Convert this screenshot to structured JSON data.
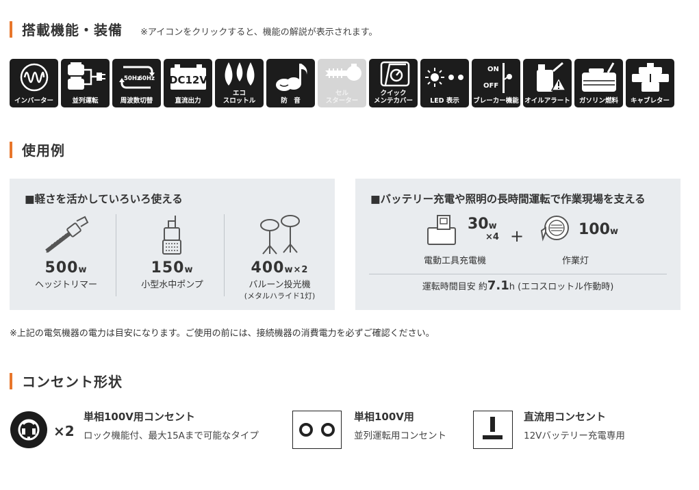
{
  "features": {
    "title": "搭載機能・装備",
    "note": "※アイコンをクリックすると、機能の解説が表示されます。",
    "icons": [
      {
        "label": "インバーター",
        "icon": "inverter-wave-icon"
      },
      {
        "label": "並列運転",
        "icon": "parallel-operation-icon"
      },
      {
        "label": "周波数切替",
        "icon": "frequency-switch-icon",
        "hz_a": "50Hz",
        "hz_b": "60Hz"
      },
      {
        "label": "直流出力",
        "icon": "dc-output-battery-icon",
        "text": "DC12V"
      },
      {
        "label": "エコ\nスロットル",
        "label_a": "エコ",
        "label_b": "スロットル",
        "icon": "eco-throttle-leaf-icon"
      },
      {
        "label": "防　音",
        "icon": "soundproof-note-icon"
      },
      {
        "label": "セル\nスターター",
        "label_a": "セル",
        "label_b": "スターター",
        "icon": "cell-starter-key-icon",
        "disabled": true
      },
      {
        "label": "クイック\nメンテカバー",
        "label_a": "クイック",
        "label_b": "メンテカバー",
        "icon": "quick-maintenance-cover-icon"
      },
      {
        "label": "LED 表示",
        "icon": "led-display-icon"
      },
      {
        "label": "ブレーカー機能",
        "icon": "breaker-switch-icon",
        "on": "ON",
        "off": "OFF"
      },
      {
        "label": "オイルアラート",
        "icon": "oil-alert-icon"
      },
      {
        "label": "ガソリン燃料",
        "icon": "gasoline-can-icon"
      },
      {
        "label": "キャブレター",
        "icon": "carburetor-icon"
      }
    ]
  },
  "usage": {
    "title": "使用例",
    "panel_left": {
      "title": "■軽さを活かしていろいろ使える",
      "items": [
        {
          "watt": "500",
          "unit": "w",
          "name": "ヘッジトリマー",
          "sub": ""
        },
        {
          "watt": "150",
          "unit": "w",
          "name": "小型水中ポンプ",
          "sub": ""
        },
        {
          "watt": "400",
          "unit": "w×2",
          "name": "バルーン投光機",
          "sub": "(メタルハライド1灯)"
        }
      ]
    },
    "panel_right": {
      "title": "■バッテリー充電や照明の長時間運転で作業現場を支える",
      "charger": {
        "watt": "30",
        "unit": "w",
        "mult": "×4",
        "name": "電動工具充電機"
      },
      "plus": "+",
      "light": {
        "watt": "100",
        "unit": "w",
        "name": "作業灯"
      },
      "runtime_prefix": "運転時間目安 約",
      "runtime_value": "7.1",
      "runtime_suffix": "h (エコスロットル作動時)"
    },
    "footnote": "※上記の電気機器の電力は目安になります。ご使用の前には、接続機器の消費電力を必ずご確認ください。"
  },
  "outlets": {
    "title": "コンセント形状",
    "items": [
      {
        "count": "×2",
        "title": "単相100V用コンセント",
        "desc": "ロック機能付、最大15Aまで可能なタイプ",
        "icon": "locking-outlet-icon"
      },
      {
        "title": "単相100V用",
        "desc": "並列運転用コンセント",
        "icon": "parallel-outlet-icon"
      },
      {
        "title": "直流用コンセント",
        "desc": "12Vバッテリー充電専用",
        "icon": "dc-outlet-icon"
      }
    ]
  },
  "colors": {
    "accent": "#e8762b",
    "tile": "#1c1c1c",
    "tile_disabled": "#d6d6d6",
    "panel": "#e9ecef"
  }
}
